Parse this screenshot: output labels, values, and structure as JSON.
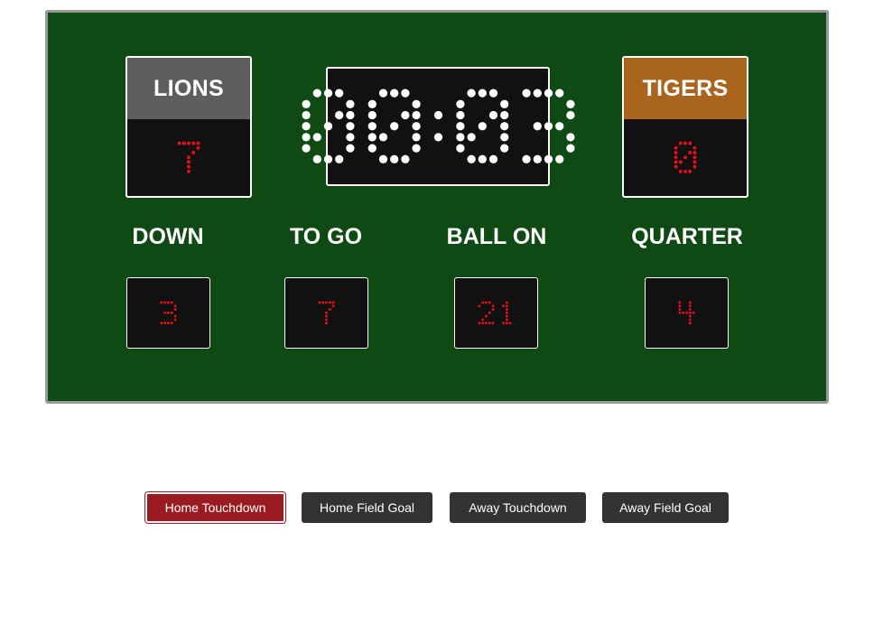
{
  "colors": {
    "board": "#0f4a14",
    "home_header": "#5e5e5e",
    "away_header": "#a9641e",
    "led_red": "#e3101a",
    "led_white": "#ffffff",
    "active_button": "#9b1b22",
    "button": "#333333"
  },
  "home": {
    "name": "LIONS",
    "score": "7"
  },
  "away": {
    "name": "TIGERS",
    "score": "0"
  },
  "clock": "00:03",
  "stats": [
    {
      "label": "DOWN",
      "value": "3"
    },
    {
      "label": "TO GO",
      "value": "7"
    },
    {
      "label": "BALL ON",
      "value": "21"
    },
    {
      "label": "QUARTER",
      "value": "4"
    }
  ],
  "buttons": [
    {
      "label": "Home Touchdown",
      "active": true
    },
    {
      "label": "Home Field Goal",
      "active": false
    },
    {
      "label": "Away Touchdown",
      "active": false
    },
    {
      "label": "Away Field Goal",
      "active": false
    }
  ]
}
